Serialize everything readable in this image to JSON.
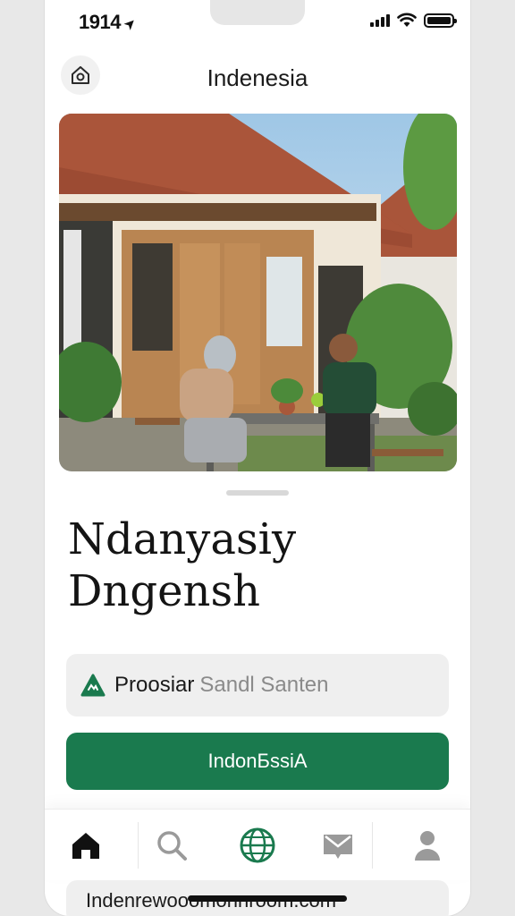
{
  "status_bar": {
    "time": "1914",
    "location_arrow": "location-arrow-icon"
  },
  "header": {
    "title": "Indenesia",
    "home_icon": "home-icon"
  },
  "hero": {
    "image_description": "photo-hero"
  },
  "headline": {
    "line1": "Ndanyasiy",
    "line2": "Dngensh"
  },
  "search": {
    "value": "Proosiar",
    "placeholder": "Sandl Santen",
    "logo_icon": "brand-logo-icon"
  },
  "primary_button": {
    "label": "IndonБssiA"
  },
  "tabs": [
    {
      "name": "home",
      "icon": "home-icon",
      "active": true
    },
    {
      "name": "search",
      "icon": "search-icon",
      "active": false
    },
    {
      "name": "globe",
      "icon": "globe-icon",
      "active": false
    },
    {
      "name": "messages",
      "icon": "mail-icon",
      "active": false
    },
    {
      "name": "profile",
      "icon": "user-icon",
      "active": false
    }
  ],
  "url_bar": {
    "text": "Indenrewooomonnroom.com"
  },
  "colors": {
    "accent": "#1a7a4e",
    "field_bg": "#efefef",
    "text": "#141414"
  }
}
